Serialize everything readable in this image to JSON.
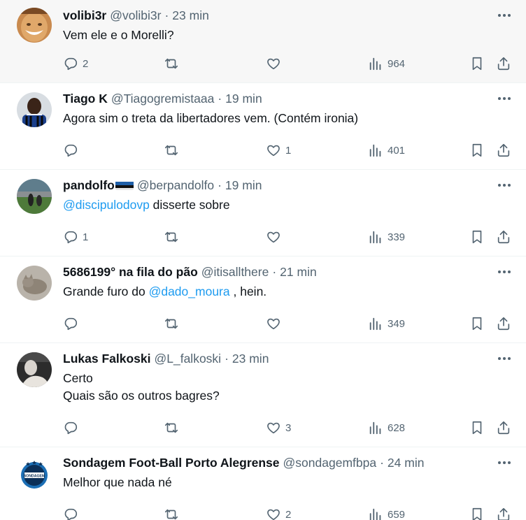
{
  "tweets": [
    {
      "name": "volibi3r",
      "flag": false,
      "handle": "@volibi3r",
      "time": "23 min",
      "text_before": "Vem ele e o Morelli?",
      "mention": "",
      "text_after": "",
      "line2": "",
      "replies": "2",
      "retweets": "",
      "likes": "",
      "views": "964",
      "avatar": "smiling-face-avatar",
      "highlighted": true
    },
    {
      "name": "Tiago K",
      "flag": false,
      "handle": "@Tiagogremistaaa",
      "time": "19 min",
      "text_before": "Agora sim o treta da libertadores vem. (Contém ironia)",
      "mention": "",
      "text_after": "",
      "line2": "",
      "replies": "",
      "retweets": "",
      "likes": "1",
      "views": "401",
      "avatar": "player-avatar",
      "highlighted": false
    },
    {
      "name": "pandolfo",
      "flag": true,
      "handle": "@berpandolfo",
      "time": "19 min",
      "text_before": "",
      "mention": "@discipulodovp",
      "text_after": " disserte sobre",
      "line2": "",
      "replies": "1",
      "retweets": "",
      "likes": "",
      "views": "339",
      "avatar": "stadium-avatar",
      "highlighted": false
    },
    {
      "name": "5686199° na fila do pão",
      "flag": false,
      "handle": "@itisallthere",
      "time": "21 min",
      "text_before": "Grande furo do ",
      "mention": "@dado_moura",
      "text_after": " , hein.",
      "line2": "",
      "replies": "",
      "retweets": "",
      "likes": "",
      "views": "349",
      "avatar": "cat-avatar",
      "highlighted": false
    },
    {
      "name": "Lukas Falkoski",
      "flag": false,
      "handle": "@L_falkoski",
      "time": "23 min",
      "text_before": "Certo",
      "mention": "",
      "text_after": "",
      "line2": "Quais são os outros bagres?",
      "replies": "",
      "retweets": "",
      "likes": "3",
      "views": "628",
      "avatar": "person-avatar",
      "highlighted": false
    },
    {
      "name": "Sondagem Foot-Ball Porto Alegrense",
      "flag": false,
      "handle": "@sondagemfbpa",
      "time": "24 min",
      "text_before": "Melhor que nada né",
      "mention": "",
      "text_after": "",
      "line2": "",
      "replies": "",
      "retweets": "",
      "likes": "2",
      "views": "659",
      "avatar": "club-crest-avatar",
      "highlighted": false
    }
  ],
  "colors": {
    "text": "#0f1419",
    "secondary": "#536471",
    "link": "#1d9bf0",
    "divider": "#eff3f4",
    "highlight_bg": "#f7f7f7"
  },
  "icons": [
    "reply-icon",
    "retweet-icon",
    "like-icon",
    "views-icon",
    "bookmark-icon",
    "share-icon",
    "more-icon"
  ]
}
